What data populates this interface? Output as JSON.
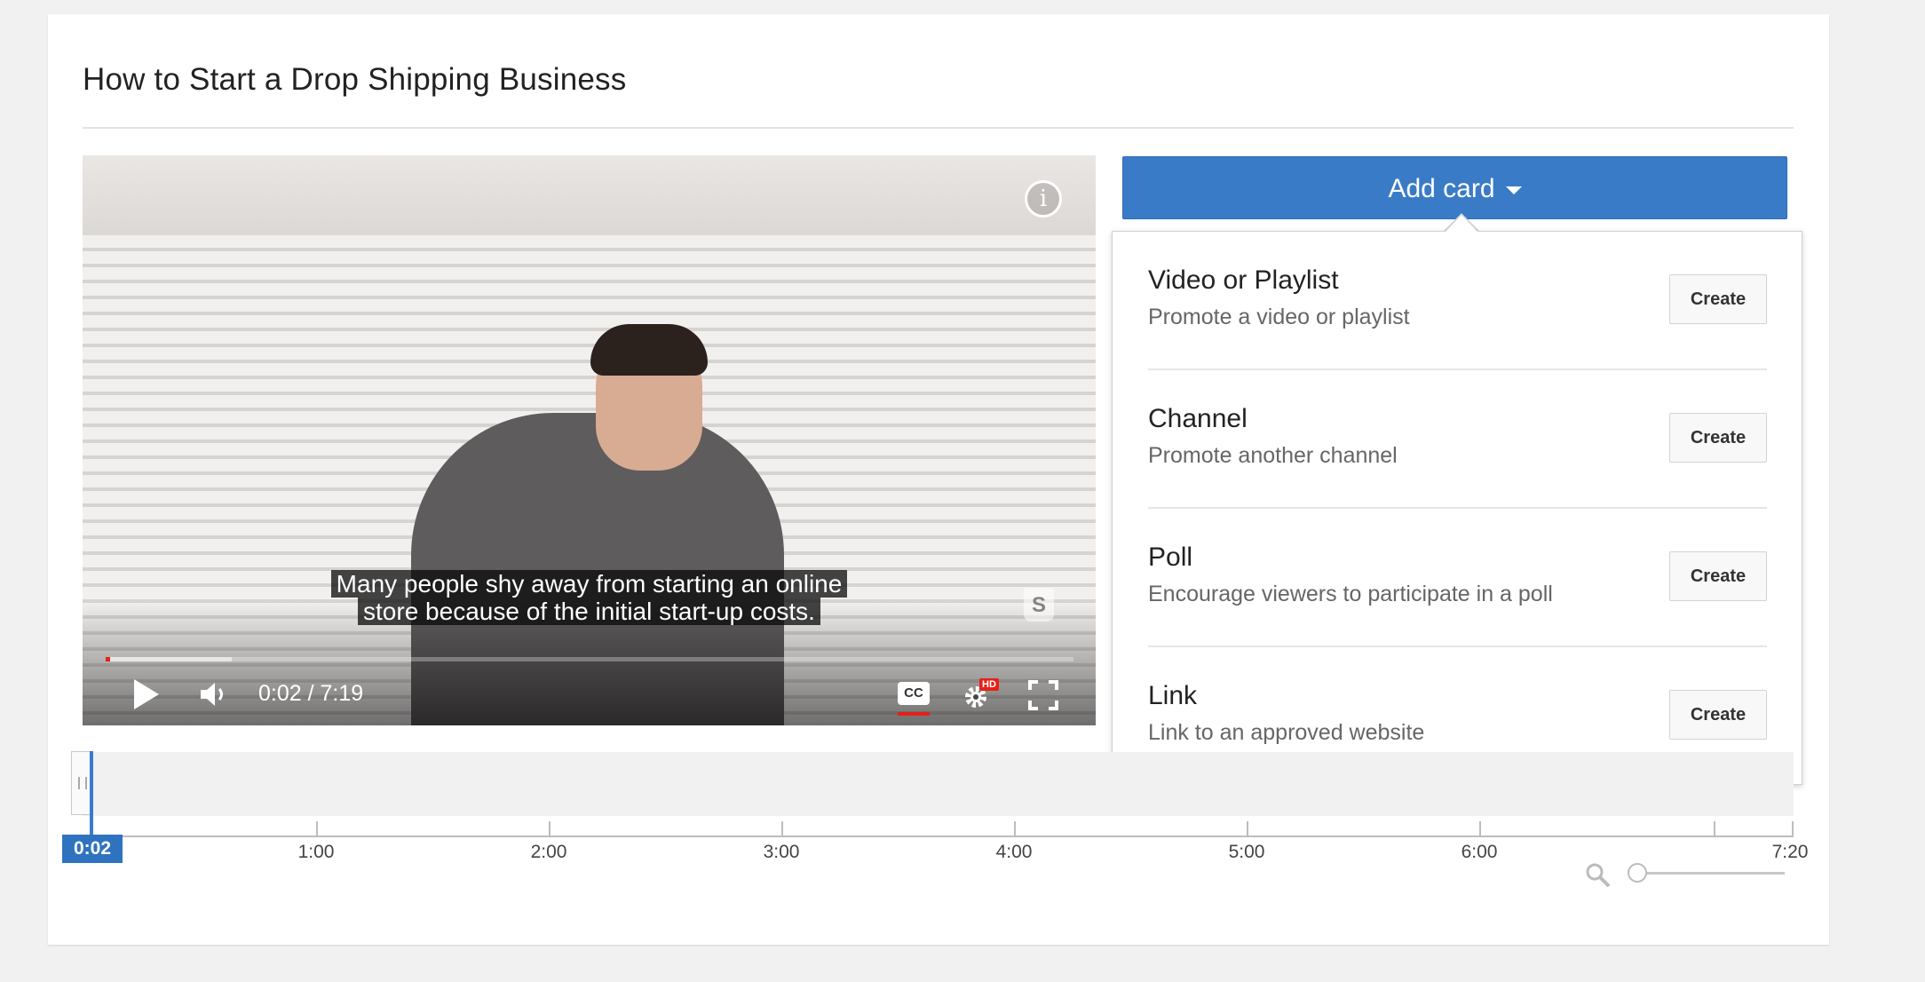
{
  "page": {
    "title": "How to Start a Drop Shipping Business"
  },
  "video": {
    "caption_line1": "Many people shy away from starting an online",
    "caption_line2": "store because of the initial start-up costs.",
    "info_icon": "info-icon",
    "time_current": "0:02",
    "time_total": "7:19",
    "time_display": "0:02 / 7:19",
    "cc_label": "CC",
    "hd_badge": "HD",
    "brand_mark": "S",
    "progress_played": 0.005,
    "progress_buffered": 0.13
  },
  "add_card": {
    "button_label": "Add card",
    "options": [
      {
        "title": "Video or Playlist",
        "description": "Promote a video or playlist",
        "action": "Create"
      },
      {
        "title": "Channel",
        "description": "Promote another channel",
        "action": "Create"
      },
      {
        "title": "Poll",
        "description": "Encourage viewers to participate in a poll",
        "action": "Create"
      },
      {
        "title": "Link",
        "description": "Link to an approved website",
        "action": "Create"
      }
    ]
  },
  "timeline": {
    "playhead_label": "0:02",
    "ticks": [
      "1:00",
      "2:00",
      "3:00",
      "4:00",
      "5:00",
      "6:00",
      "7:20"
    ]
  },
  "colors": {
    "accent": "#3a7bc8",
    "progress_red": "#e62117"
  }
}
